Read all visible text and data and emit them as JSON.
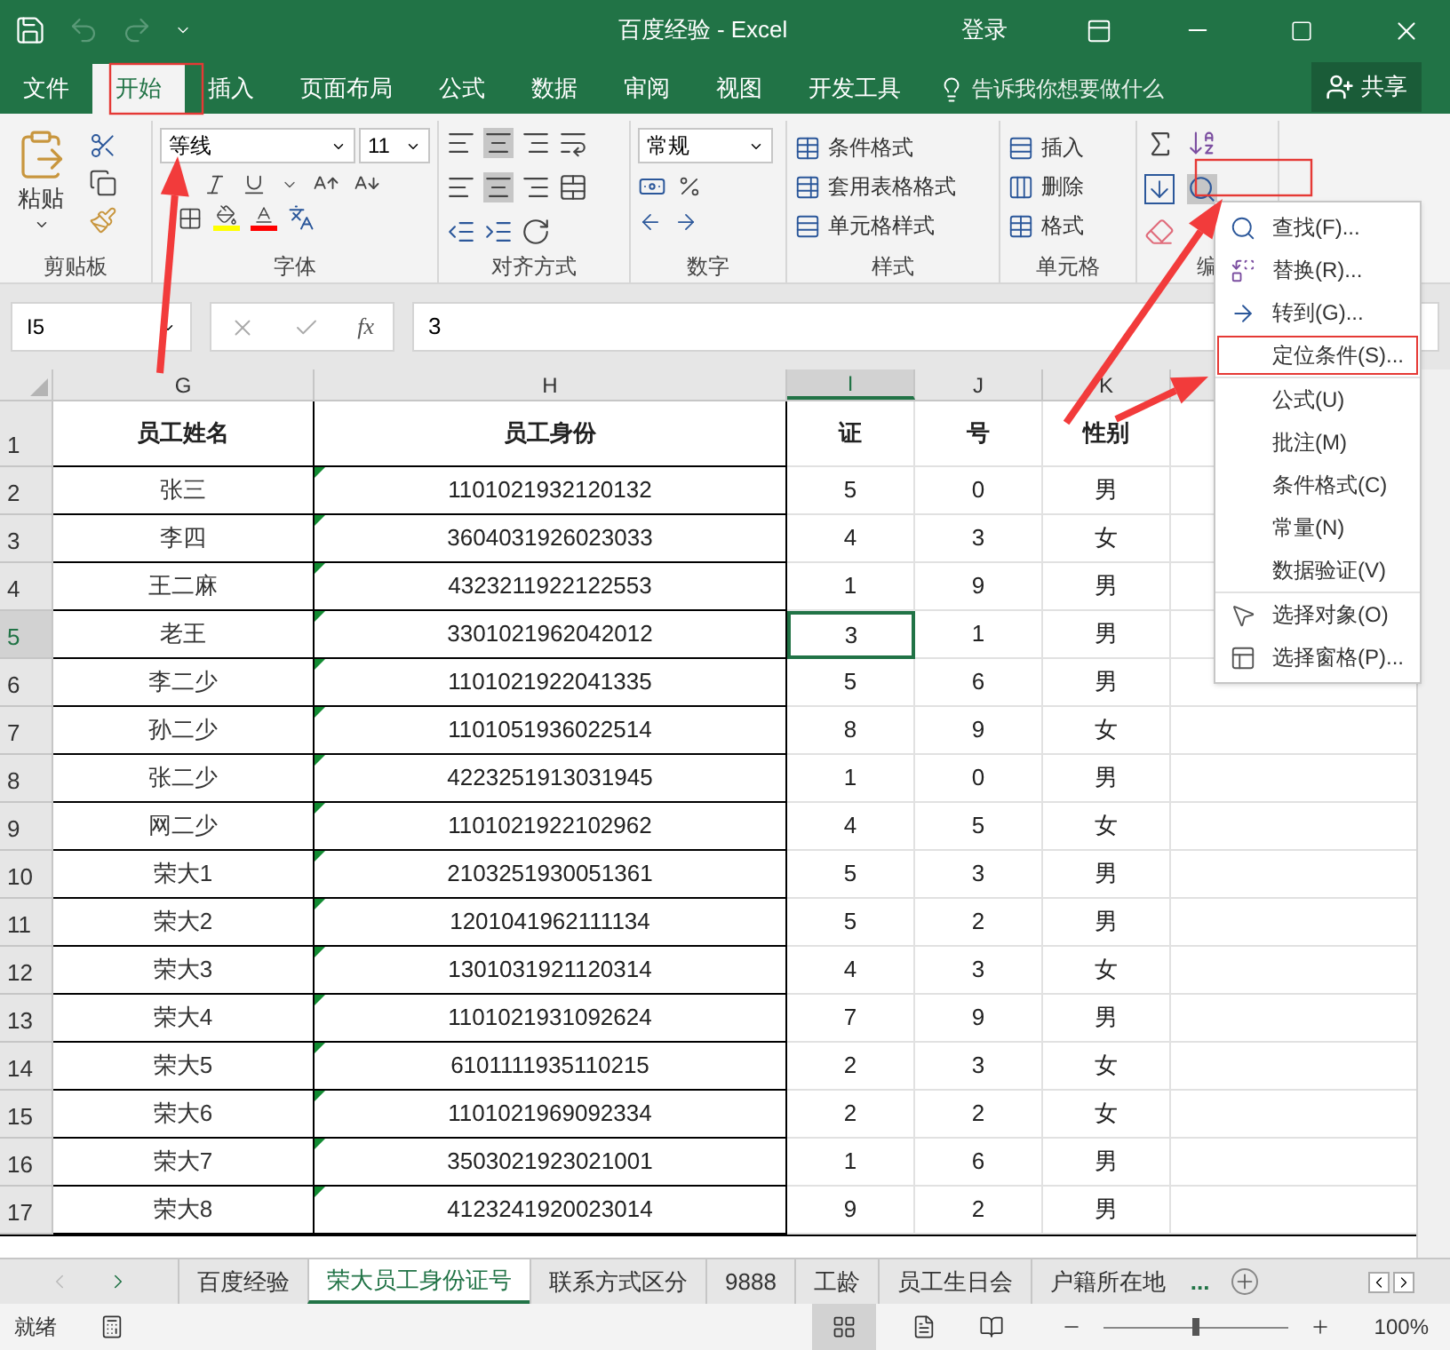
{
  "title_bar": {
    "title": "百度经验 - Excel",
    "account": "登录"
  },
  "ribbon_tabs": [
    {
      "label": "文件",
      "selected": false
    },
    {
      "label": "开始",
      "selected": true
    },
    {
      "label": "插入",
      "selected": false
    },
    {
      "label": "页面布局",
      "selected": false
    },
    {
      "label": "公式",
      "selected": false
    },
    {
      "label": "数据",
      "selected": false
    },
    {
      "label": "审阅",
      "selected": false
    },
    {
      "label": "视图",
      "selected": false
    },
    {
      "label": "开发工具",
      "selected": false
    }
  ],
  "tell_me": "告诉我你想要做什么",
  "share": "共享",
  "ribbon": {
    "paste": "粘贴",
    "font_name": "等线",
    "font_size": "11",
    "number_format": "常规",
    "styles": [
      "条件格式",
      "套用表格格式",
      "单元格样式"
    ],
    "cells": [
      "插入",
      "删除",
      "格式"
    ],
    "groups": [
      "剪贴板",
      "字体",
      "对齐方式",
      "数字",
      "样式",
      "单元格",
      "编"
    ]
  },
  "formula_bar": {
    "name_box": "I5",
    "fx": "fx",
    "value": "3"
  },
  "columns": [
    {
      "label": "G",
      "selected": false
    },
    {
      "label": "H",
      "selected": false
    },
    {
      "label": "I",
      "selected": true
    },
    {
      "label": "J",
      "selected": false
    },
    {
      "label": "K",
      "selected": false
    }
  ],
  "rows": [
    {
      "number": "1",
      "selected": false,
      "header": true,
      "cells": [
        "员工姓名",
        "员工身份",
        "证",
        "号",
        "性别"
      ]
    },
    {
      "number": "2",
      "selected": false,
      "cells": [
        "张三",
        "1101021932120132",
        "5",
        "0",
        "男"
      ]
    },
    {
      "number": "3",
      "selected": false,
      "cells": [
        "李四",
        "3604031926023033",
        "4",
        "3",
        "女"
      ]
    },
    {
      "number": "4",
      "selected": false,
      "cells": [
        "王二麻",
        "4323211922122553",
        "1",
        "9",
        "男"
      ]
    },
    {
      "number": "5",
      "selected": true,
      "cells": [
        "老王",
        "3301021962042012",
        "3",
        "1",
        "男"
      ]
    },
    {
      "number": "6",
      "selected": false,
      "cells": [
        "李二少",
        "1101021922041335",
        "5",
        "6",
        "男"
      ]
    },
    {
      "number": "7",
      "selected": false,
      "cells": [
        "孙二少",
        "1101051936022514",
        "8",
        "9",
        "女"
      ]
    },
    {
      "number": "8",
      "selected": false,
      "cells": [
        "张二少",
        "4223251913031945",
        "1",
        "0",
        "男"
      ]
    },
    {
      "number": "9",
      "selected": false,
      "cells": [
        "网二少",
        "1101021922102962",
        "4",
        "5",
        "女"
      ]
    },
    {
      "number": "10",
      "selected": false,
      "cells": [
        "荣大1",
        "2103251930051361",
        "5",
        "3",
        "男"
      ]
    },
    {
      "number": "11",
      "selected": false,
      "cells": [
        "荣大2",
        "1201041962111134",
        "5",
        "2",
        "男"
      ]
    },
    {
      "number": "12",
      "selected": false,
      "cells": [
        "荣大3",
        "1301031921120314",
        "4",
        "3",
        "女"
      ]
    },
    {
      "number": "13",
      "selected": false,
      "cells": [
        "荣大4",
        "1101021931092624",
        "7",
        "9",
        "男"
      ]
    },
    {
      "number": "14",
      "selected": false,
      "cells": [
        "荣大5",
        "6101111935110215",
        "2",
        "3",
        "女"
      ]
    },
    {
      "number": "15",
      "selected": false,
      "cells": [
        "荣大6",
        "1101021969092334",
        "2",
        "2",
        "女"
      ]
    },
    {
      "number": "16",
      "selected": false,
      "cells": [
        "荣大7",
        "3503021923021001",
        "1",
        "6",
        "男"
      ]
    },
    {
      "number": "17",
      "selected": false,
      "cells": [
        "荣大8",
        "4123241920023014",
        "9",
        "2",
        "男"
      ]
    }
  ],
  "find_menu": {
    "sections": [
      [
        {
          "label": "查找(F)...",
          "kind": "find",
          "highlighted": false
        },
        {
          "label": "替换(R)...",
          "kind": "replace",
          "highlighted": false
        },
        {
          "label": "转到(G)...",
          "kind": "goto",
          "highlighted": false
        },
        {
          "label": "定位条件(S)...",
          "kind": "plain",
          "highlighted": true
        }
      ],
      [
        {
          "label": "公式(U)",
          "kind": "plain",
          "highlighted": false
        },
        {
          "label": "批注(M)",
          "kind": "plain",
          "highlighted": false
        },
        {
          "label": "条件格式(C)",
          "kind": "plain",
          "highlighted": false
        },
        {
          "label": "常量(N)",
          "kind": "plain",
          "highlighted": false
        },
        {
          "label": "数据验证(V)",
          "kind": "plain",
          "highlighted": false
        }
      ],
      [
        {
          "label": "选择对象(O)",
          "kind": "pointer",
          "highlighted": false
        },
        {
          "label": "选择窗格(P)...",
          "kind": "pane",
          "highlighted": false
        }
      ]
    ]
  },
  "sheet_tabs": [
    {
      "label": "百度经验",
      "selected": false
    },
    {
      "label": "荣大员工身份证号",
      "selected": true
    },
    {
      "label": "联系方式区分",
      "selected": false
    },
    {
      "label": "9888",
      "selected": false
    },
    {
      "label": "工龄",
      "selected": false
    },
    {
      "label": "员工生日会",
      "selected": false
    },
    {
      "label": "户籍所在地",
      "selected": false
    }
  ],
  "more_tabs": "...",
  "status_bar": {
    "status": "就绪",
    "zoom": "100%",
    "level": 0.5
  }
}
